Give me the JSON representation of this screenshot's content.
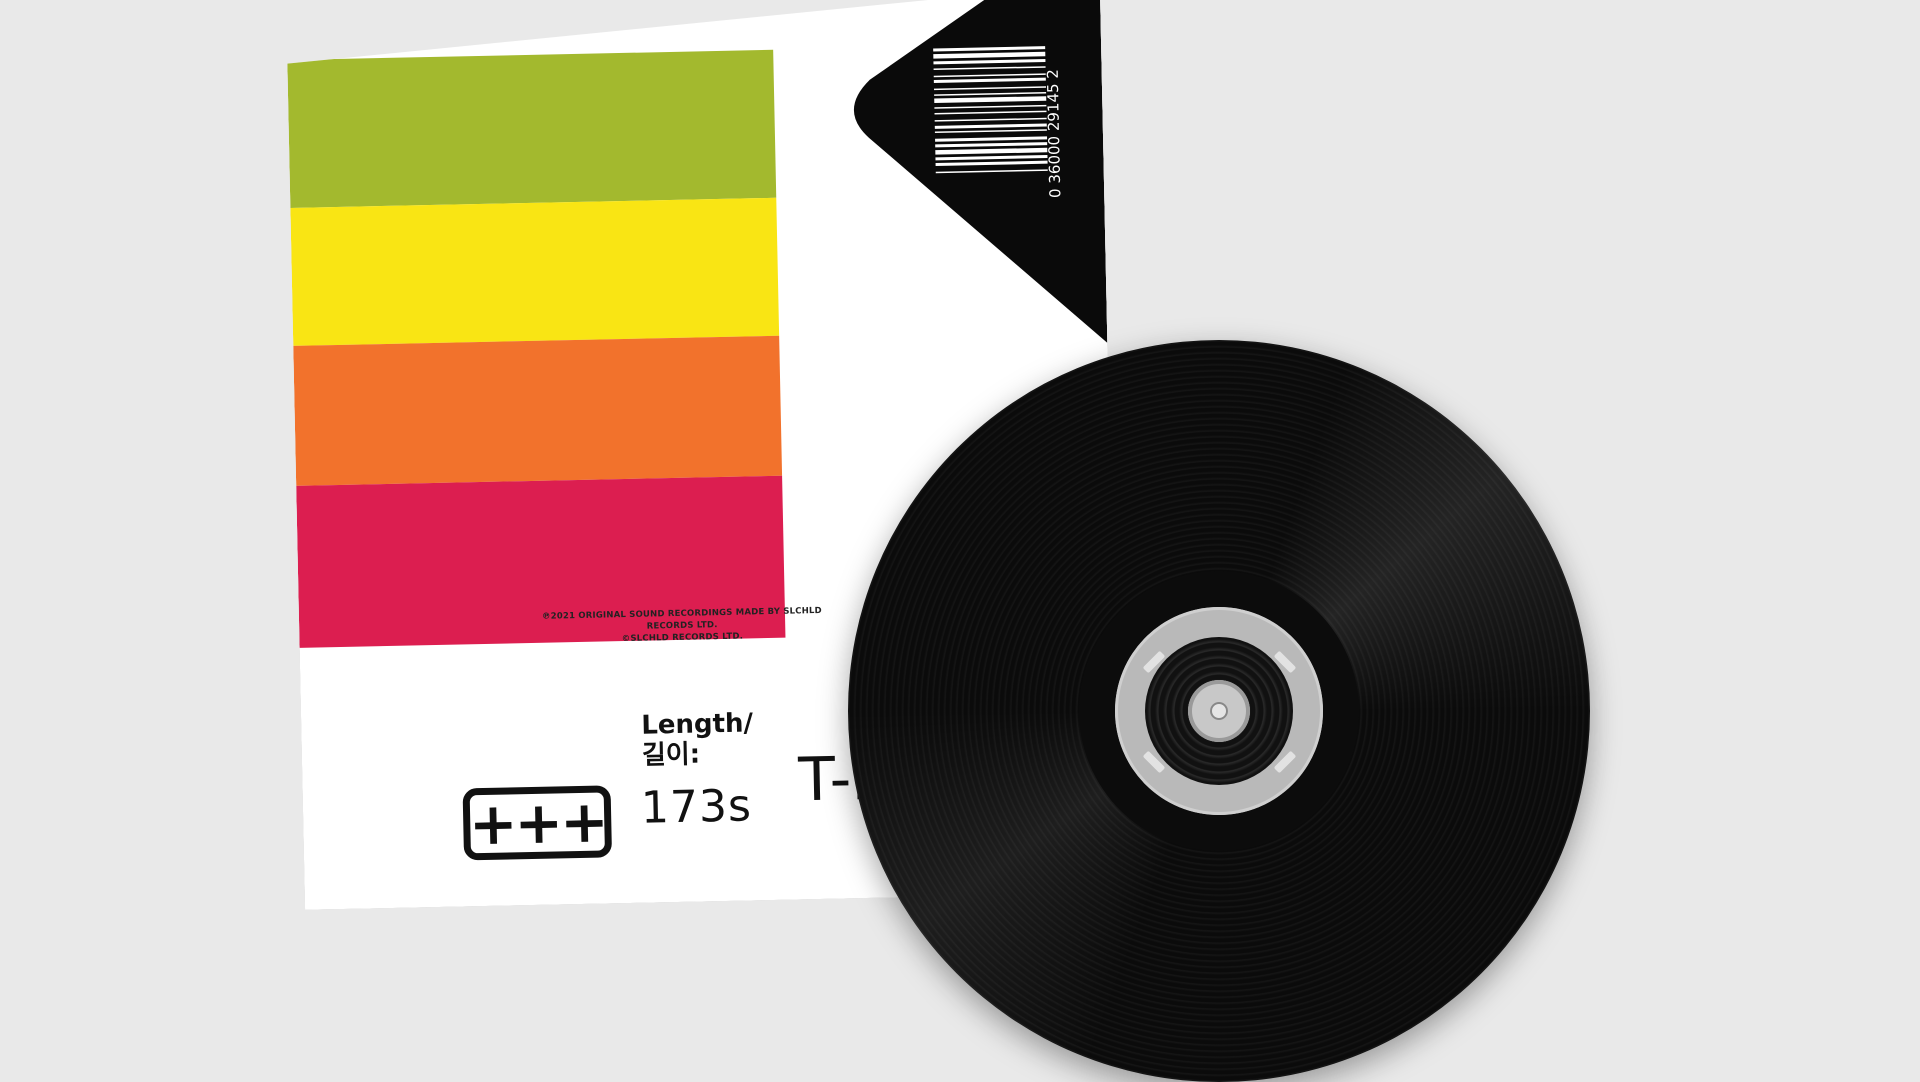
{
  "sleeve": {
    "stripe_colors": [
      "#a3b92e",
      "#f9e514",
      "#f2722c",
      "#dc1e50"
    ],
    "copyright_lines": [
      "℗2021 ORIGINAL SOUND RECORDINGS MADE BY SLCHLD RECORDS LTD.",
      "©SLCHLD RECORDS LTD."
    ],
    "length_label_en": "Length/",
    "length_label_ko": "길이:",
    "length_value": "173s",
    "track_code": "T-I",
    "logo_text": "+++",
    "barcode_number": "0 36000 29145 2"
  },
  "record": {
    "color": "#0b0b0b",
    "label_color": "#b9b9b9"
  }
}
